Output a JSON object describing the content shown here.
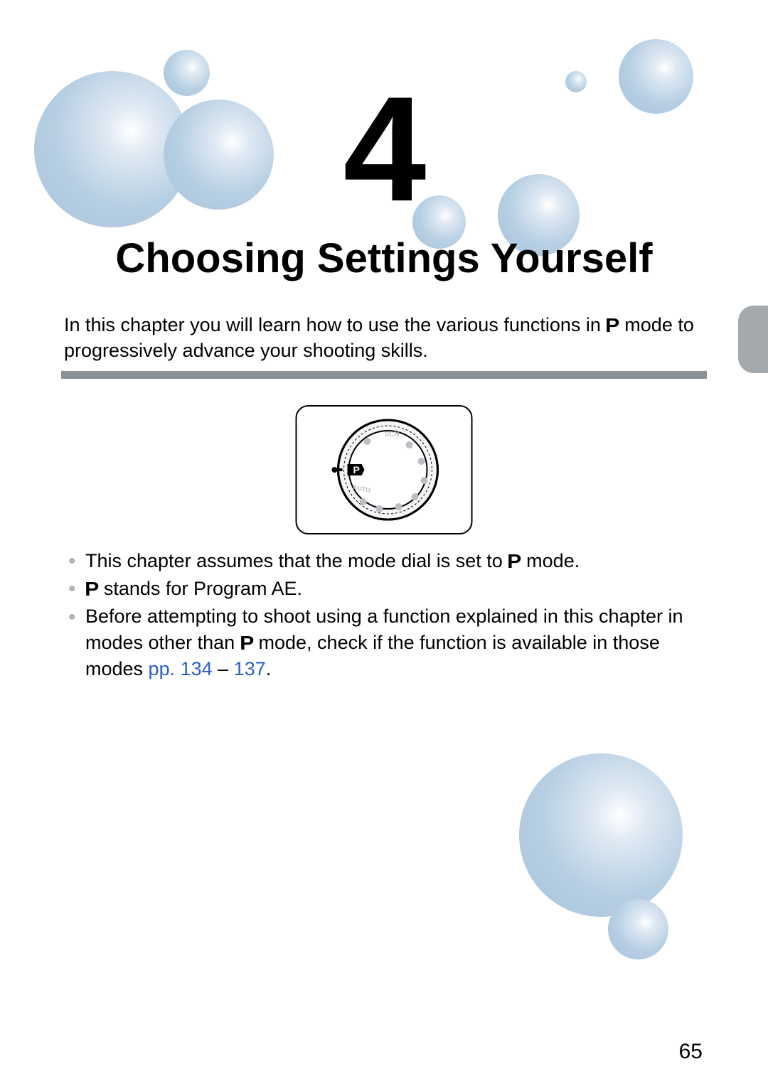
{
  "chapter": {
    "number": "4",
    "title": "Choosing Settings Yourself"
  },
  "intro": {
    "part1": "In this chapter you will learn how to use the various functions in ",
    "mode_icon": "P",
    "part2": " mode to progressively advance your shooting skills."
  },
  "dial": {
    "label": "P",
    "auto": "AUTO",
    "modes": [
      "SCN"
    ]
  },
  "bullets": {
    "b1a": "This chapter assumes that the mode dial is set to ",
    "b1_icon": "P",
    "b1b": " mode.",
    "b2_icon": "P",
    "b2b": " stands for Program AE.",
    "b3a": "Before attempting to shoot using a function explained in this chapter in modes other than ",
    "b3_icon": "P",
    "b3b": " mode, check if the function is available in those modes ",
    "b3_link1": "pp. 134",
    "b3_mid": " – ",
    "b3_link2": "137",
    "b3_end": "."
  },
  "page_number": "65"
}
